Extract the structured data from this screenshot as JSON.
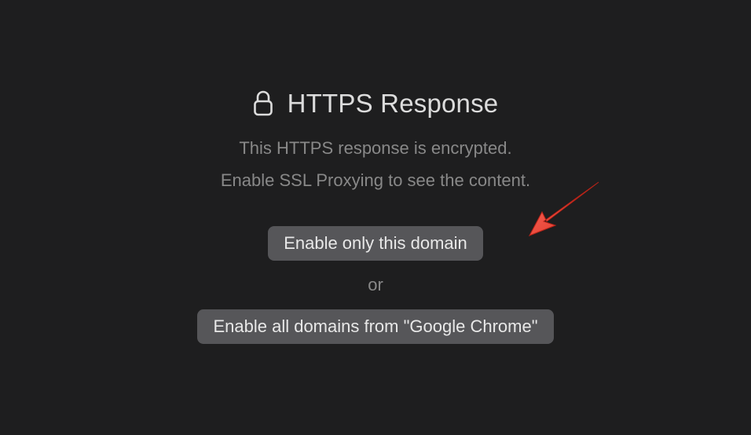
{
  "title": "HTTPS Response",
  "subtitle_line1": "This HTTPS response is encrypted.",
  "subtitle_line2": "Enable SSL Proxying to see the content.",
  "button_enable_domain": "Enable only this domain",
  "or_label": "or",
  "button_enable_all": "Enable all domains from \"Google Chrome\""
}
